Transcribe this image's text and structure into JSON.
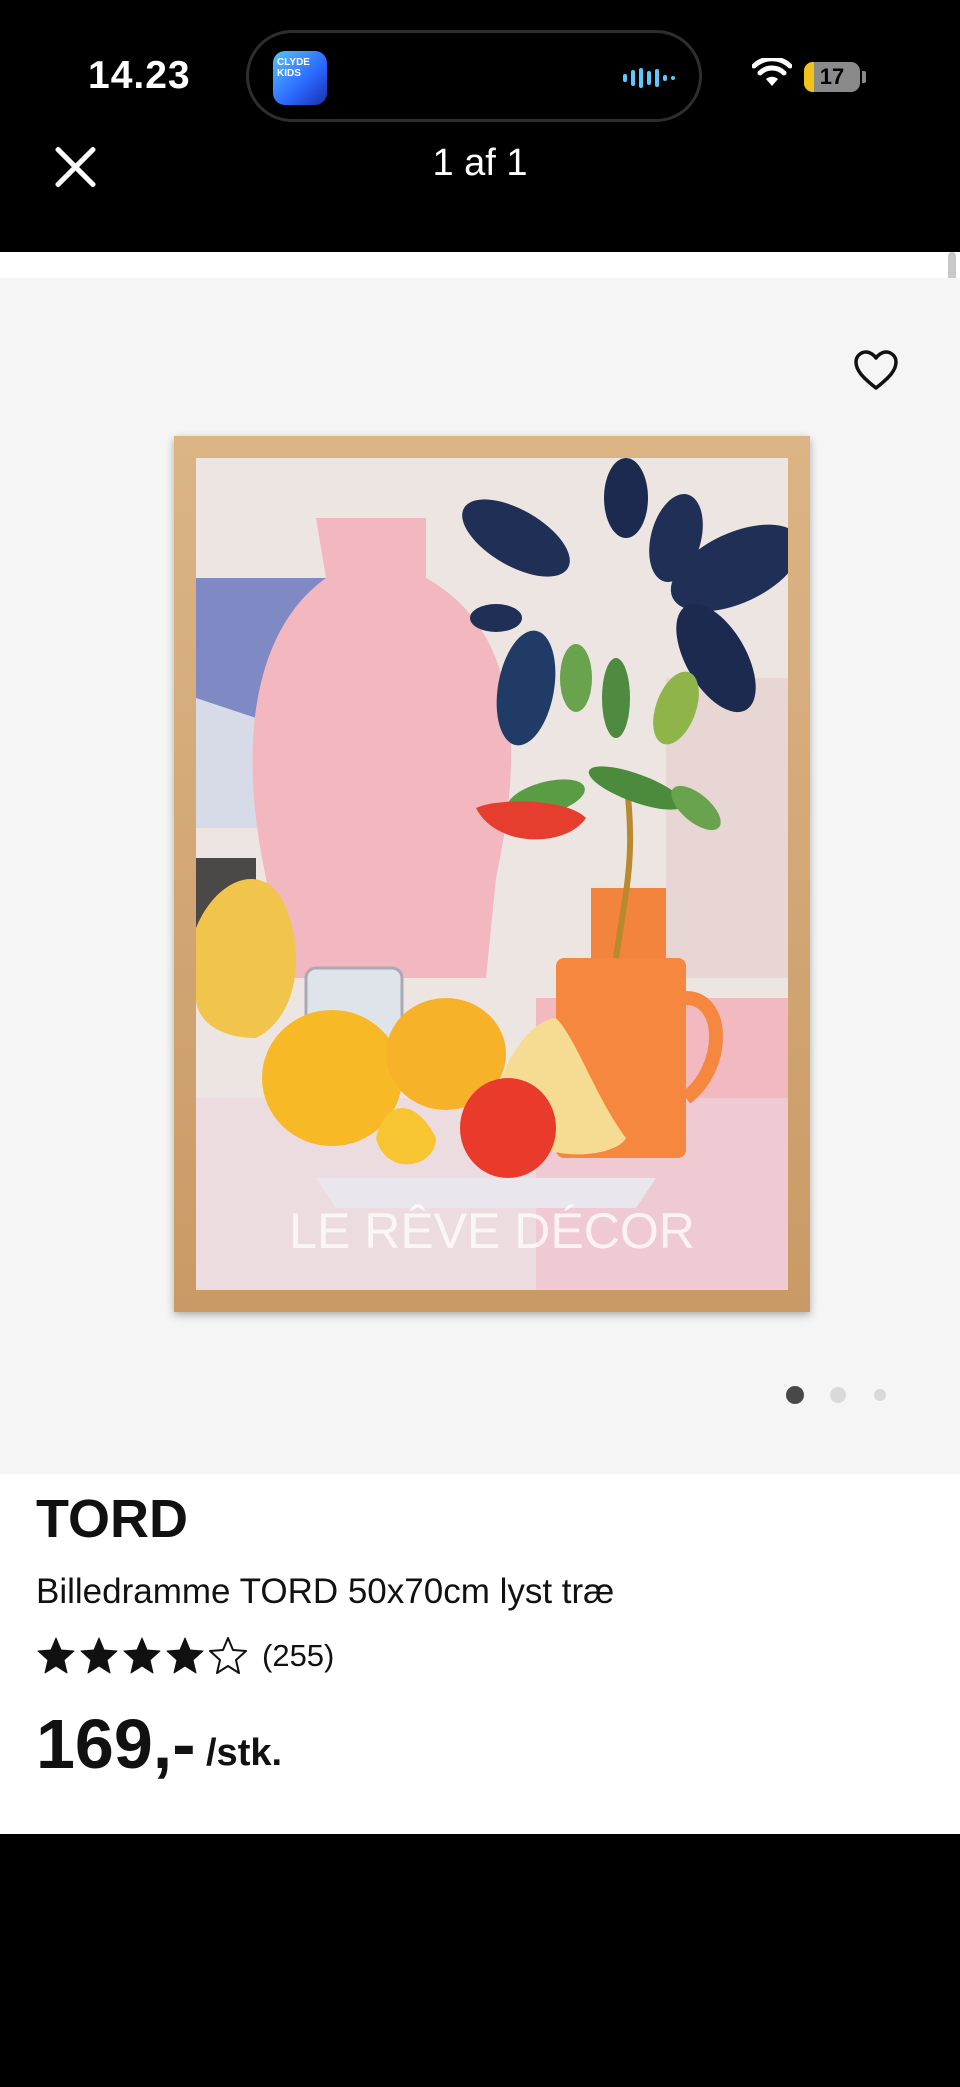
{
  "status_bar": {
    "time": "14.23",
    "battery": "17",
    "battery_level": 0.17,
    "app_thumb_text": "CLYDE KIDS"
  },
  "viewer": {
    "close_icon": "close-icon",
    "pager": "1 af 1"
  },
  "gallery": {
    "watermark": "LE RÊVE DÉCOR",
    "active_index": 0,
    "count": 3
  },
  "product": {
    "brand": "TORD",
    "description": "Billedramme TORD 50x70cm lyst træ",
    "rating": 4,
    "rating_max": 5,
    "reviews": "(255)",
    "price": "169,-",
    "unit": "/stk."
  },
  "colors": {
    "accent_star": "#111111",
    "battery_fill": "#f2c319",
    "frame": "#d4aa78"
  }
}
